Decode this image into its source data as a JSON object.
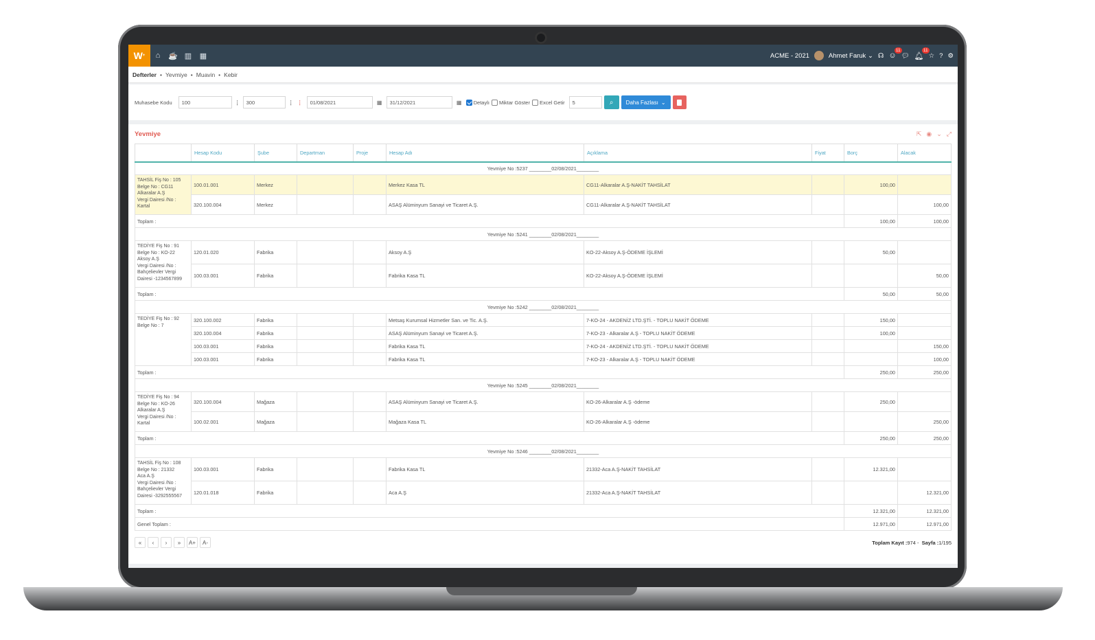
{
  "topbar": {
    "logo": "W",
    "company": "ACME - 2021",
    "user": "Ahmet Faruk",
    "notif1": "11",
    "notif2": "11"
  },
  "breadcrumb": [
    "Defterler",
    "Yevmiye",
    "Muavin",
    "Kebir"
  ],
  "filters": {
    "label": "Muhasebe Kodu",
    "code_from": "100",
    "code_to": "300",
    "date_from": "01/08/2021",
    "date_to": "31/12/2021",
    "detayli": "Detaylı",
    "miktar": "Miktar Göster",
    "excel": "Excel Getir",
    "count": "5",
    "more": "Daha Fazlası"
  },
  "panel": {
    "title": "Yevmiye"
  },
  "columns": [
    "",
    "Hesap Kodu",
    "Şube",
    "Departman",
    "Proje",
    "Hesap Adı",
    "Açıklama",
    "Fiyat",
    "Borç",
    "Alacak"
  ],
  "rows": [
    {
      "t": "yno",
      "text": "Yevmiye No :5237     ________02/08/2021________"
    },
    {
      "t": "line",
      "h": 29,
      "hl": true,
      "fis": "TAHSİL Fiş No : 105\nBelge No : CG11\nAlkaralar A.Ş\nVergi Dairesi /No :\nKartal",
      "span": 2,
      "code": "100.01.001",
      "sube": "Merkez",
      "ad": "Merkez Kasa TL",
      "acik": "CG11-Alkaralar A.Ş-NAKİT TAHSİLAT",
      "borc": "100,00",
      "alacak": ""
    },
    {
      "t": "line",
      "h": 29,
      "code": "320.100.004",
      "sube": "Merkez",
      "ad": "ASAŞ Alüminyum Sanayi ve Ticaret A.Ş.",
      "acik": "CG11-Alkaralar A.Ş-NAKİT TAHSİLAT",
      "borc": "",
      "alacak": "100,00"
    },
    {
      "t": "total",
      "label": "Toplam :",
      "borc": "100,00",
      "alacak": "100,00"
    },
    {
      "t": "yno",
      "text": "Yevmiye No :5241     ________02/08/2021________"
    },
    {
      "t": "line",
      "h": 34,
      "fis": "TEDİYE Fiş No : 91\nBelge No : KO-22\nAksoy A.Ş\nVergi Dairesi /No :\nBahçelievler Vergi\nDairesi -1234567899",
      "span": 2,
      "code": "120.01.020",
      "sube": "Fabrika",
      "ad": "Aksoy A.Ş",
      "acik": "KO-22-Aksoy A.Ş-ÖDEME İŞLEMİ",
      "borc": "50,00",
      "alacak": ""
    },
    {
      "t": "line",
      "h": 34,
      "code": "100.03.001",
      "sube": "Fabrika",
      "ad": "Fabrika Kasa TL",
      "acik": "KO-22-Aksoy A.Ş-ÖDEME İŞLEMİ",
      "borc": "",
      "alacak": "50,00"
    },
    {
      "t": "total",
      "label": "Toplam :",
      "borc": "50,00",
      "alacak": "50,00"
    },
    {
      "t": "yno",
      "text": "Yevmiye No :5242     ________02/08/2021________"
    },
    {
      "t": "line",
      "h": 19,
      "fis": "TEDİYE Fiş No : 92\nBelge No : 7",
      "span": 4,
      "code": "320.100.002",
      "sube": "Fabrika",
      "ad": "Metsaş Kurumsal Hizmetler San. ve Tic. A.Ş.",
      "acik": "7-KO-24 - AKDENİZ LTD.ŞTİ. - TOPLU NAKİT ÖDEME",
      "borc": "150,00",
      "alacak": ""
    },
    {
      "t": "line",
      "h": 19,
      "code": "320.100.004",
      "sube": "Fabrika",
      "ad": "ASAŞ Alüminyum Sanayi ve Ticaret A.Ş.",
      "acik": "7-KO-23 - Alkaralar A.Ş - TOPLU NAKİT ÖDEME",
      "borc": "100,00",
      "alacak": ""
    },
    {
      "t": "line",
      "h": 19,
      "code": "100.03.001",
      "sube": "Fabrika",
      "ad": "Fabrika Kasa TL",
      "acik": "7-KO-24 - AKDENİZ LTD.ŞTİ. - TOPLU NAKİT ÖDEME",
      "borc": "",
      "alacak": "150,00"
    },
    {
      "t": "line",
      "h": 19,
      "code": "100.03.001",
      "sube": "Fabrika",
      "ad": "Fabrika Kasa TL",
      "acik": "7-KO-23 - Alkaralar A.Ş - TOPLU NAKİT ÖDEME",
      "borc": "",
      "alacak": "100,00"
    },
    {
      "t": "total",
      "label": "Toplam :",
      "borc": "250,00",
      "alacak": "250,00"
    },
    {
      "t": "yno",
      "text": "Yevmiye No :5245     ________02/08/2021________"
    },
    {
      "t": "line",
      "h": 29,
      "fis": "TEDİYE Fiş No : 94\nBelge No : KO-26\nAlkaralar A.Ş\nVergi Dairesi /No :\nKartal",
      "span": 2,
      "code": "320.100.004",
      "sube": "Mağaza",
      "ad": "ASAŞ Alüminyum Sanayi ve Ticaret A.Ş.",
      "acik": "KO-26-Alkaralar A.Ş -ödeme",
      "borc": "250,00",
      "alacak": ""
    },
    {
      "t": "line",
      "h": 29,
      "code": "100.02.001",
      "sube": "Mağaza",
      "ad": "Mağaza Kasa TL",
      "acik": "KO-26-Alkaralar A.Ş -ödeme",
      "borc": "",
      "alacak": "250,00"
    },
    {
      "t": "total",
      "label": "Toplam :",
      "borc": "250,00",
      "alacak": "250,00"
    },
    {
      "t": "yno",
      "text": "Yevmiye No :5246     ________02/08/2021________"
    },
    {
      "t": "line",
      "h": 34,
      "fis": "TAHSİL Fiş No : 108\nBelge No : 21332\nAca A.Ş\nVergi Dairesi /No :\nBahçelievler Vergi\nDairesi -3292555567",
      "span": 2,
      "code": "100.03.001",
      "sube": "Fabrika",
      "ad": "Fabrika Kasa TL",
      "acik": "21332-Aca A.Ş-NAKİT TAHSİLAT",
      "borc": "12.321,00",
      "alacak": ""
    },
    {
      "t": "line",
      "h": 34,
      "code": "120.01.018",
      "sube": "Fabrika",
      "ad": "Aca A.Ş",
      "acik": "21332-Aca A.Ş-NAKİT TAHSİLAT",
      "borc": "",
      "alacak": "12.321,00"
    },
    {
      "t": "total",
      "label": "Toplam :",
      "borc": "12.321,00",
      "alacak": "12.321,00"
    },
    {
      "t": "total",
      "label": "Genel Toplam :",
      "borc": "12.971,00",
      "alacak": "12.971,00"
    }
  ],
  "pager": {
    "first": "«",
    "prev": "‹",
    "next": "›",
    "last": "»",
    "font_up": "A+",
    "font_down": "A-",
    "total_label": "Toplam Kayıt :",
    "total": "974",
    "page_label": "Sayfa :",
    "page": "1/195"
  }
}
